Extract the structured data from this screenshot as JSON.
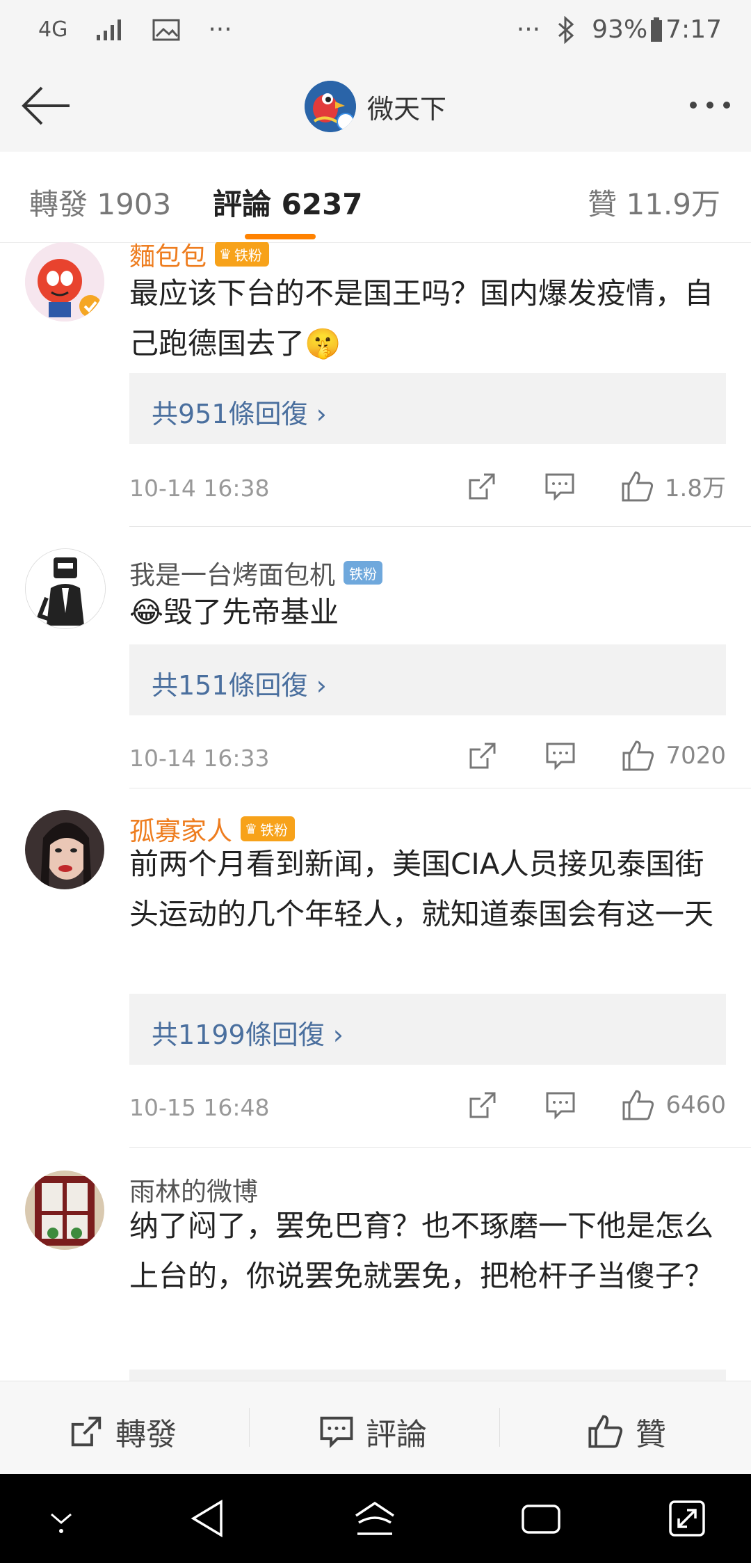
{
  "status_bar": {
    "network": "4G",
    "dots_left": "···",
    "dots_right": "···",
    "battery": "93%",
    "time": "7:17"
  },
  "header": {
    "title": "微天下"
  },
  "tabs": [
    {
      "label": "轉發 1903",
      "active": false
    },
    {
      "label": "評論 6237",
      "active": true
    },
    {
      "label": "贊 11.9万",
      "active": false
    }
  ],
  "comments": [
    {
      "username": "麵包包",
      "badge": "铁粉",
      "vip": true,
      "text": "最应该下台的不是国王吗？国内爆发疫情，自己跑德国去了🤫",
      "replies": "共951條回復 ›",
      "time": "10-14 16:38",
      "likes": "1.8万"
    },
    {
      "username": "我是一台烤面包机",
      "badge": "铁粉",
      "vip": false,
      "text": "😂毁了先帝基业",
      "replies": "共151條回復 ›",
      "time": "10-14 16:33",
      "likes": "7020"
    },
    {
      "username": "孤寡家人",
      "badge": "铁粉",
      "vip": true,
      "text": "前两个月看到新闻，美国CIA人员接见泰国街头运动的几个年轻人，就知道泰国会有这一天",
      "replies": "共1199條回復 ›",
      "time": "10-15 16:48",
      "likes": "6460"
    },
    {
      "username": "雨林的微博",
      "badge": "",
      "vip": false,
      "text": "纳了闷了，罢免巴育？也不琢磨一下他是怎么上台的，你说罢免就罢免，把枪杆子当傻子？",
      "replies": "",
      "time": "",
      "likes": ""
    }
  ],
  "bottom_bar": {
    "repost": "轉發",
    "comment": "評論",
    "like": "贊"
  },
  "colors": {
    "accent": "#ff8200",
    "link": "#4a6f9e",
    "vip_name": "#ee7d1f"
  }
}
